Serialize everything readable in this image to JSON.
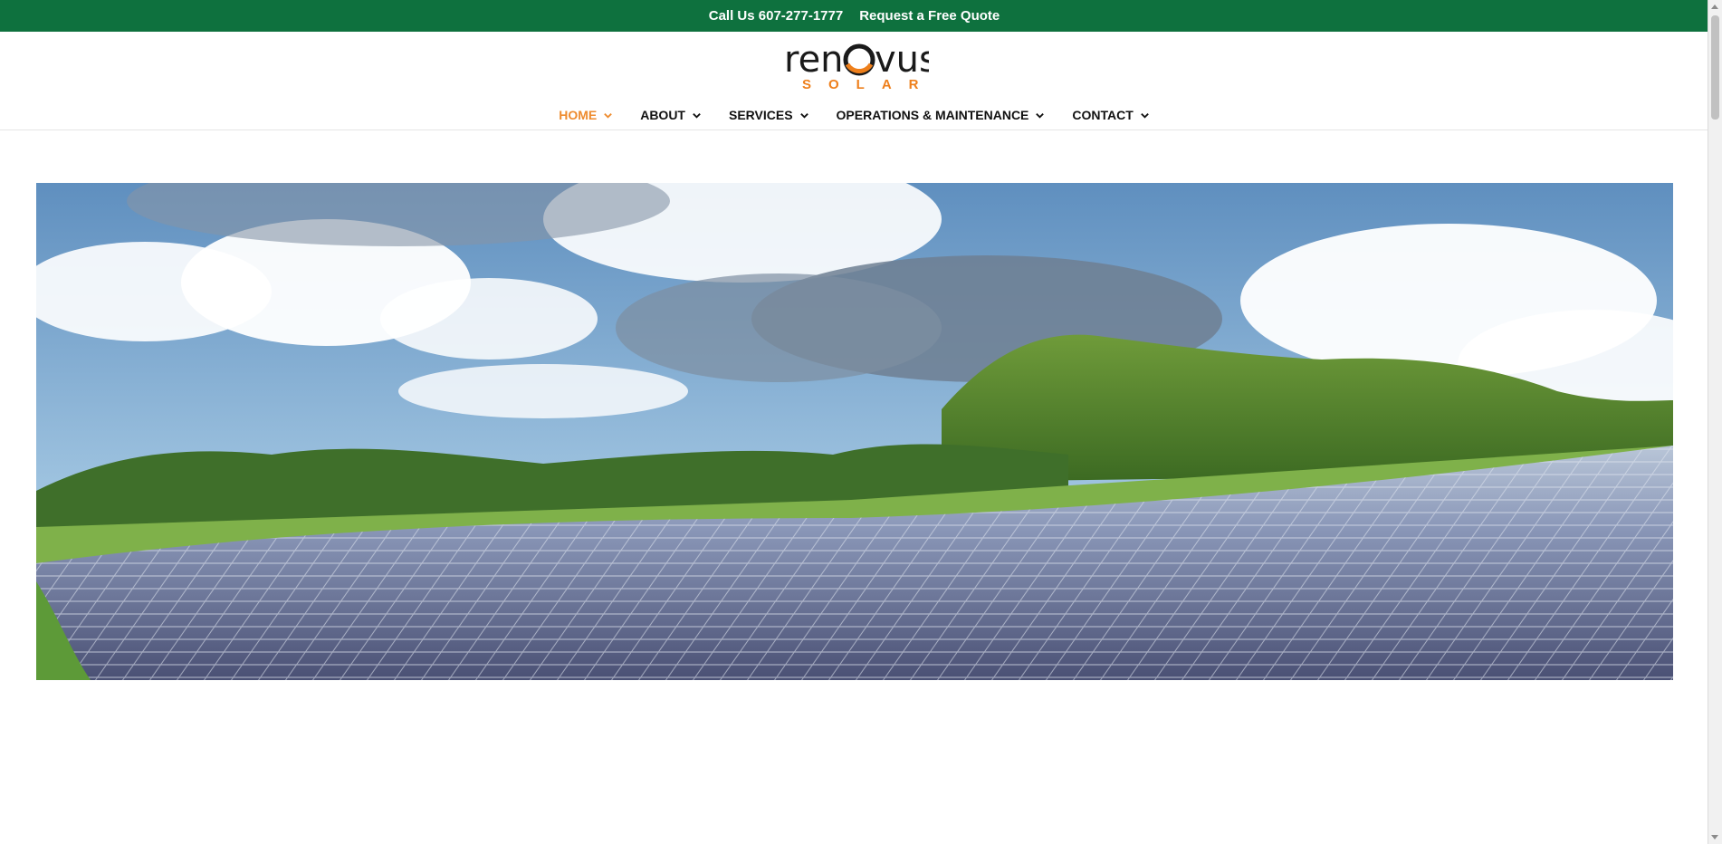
{
  "topbar": {
    "phone_label": "Call Us 607-277-1777",
    "quote_label": "Request a Free Quote",
    "bg_color": "#0e713e"
  },
  "logo": {
    "wordmark": "renovus",
    "subtext": "SOLAR",
    "accent_color": "#ee7f1b"
  },
  "nav": {
    "items": [
      {
        "label": "HOME",
        "icon": "chevron-down-icon",
        "active": true
      },
      {
        "label": "ABOUT",
        "icon": "chevron-down-icon"
      },
      {
        "label": "SERVICES",
        "icon": "chevron-down-icon"
      },
      {
        "label": "OPERATIONS & MAINTENANCE",
        "icon": "chevron-down-icon"
      },
      {
        "label": "CONTACT",
        "icon": "chevron-down-icon"
      }
    ],
    "active_color": "#ee8b2e"
  },
  "hero": {
    "image": "solar-farm-hills-photo"
  }
}
